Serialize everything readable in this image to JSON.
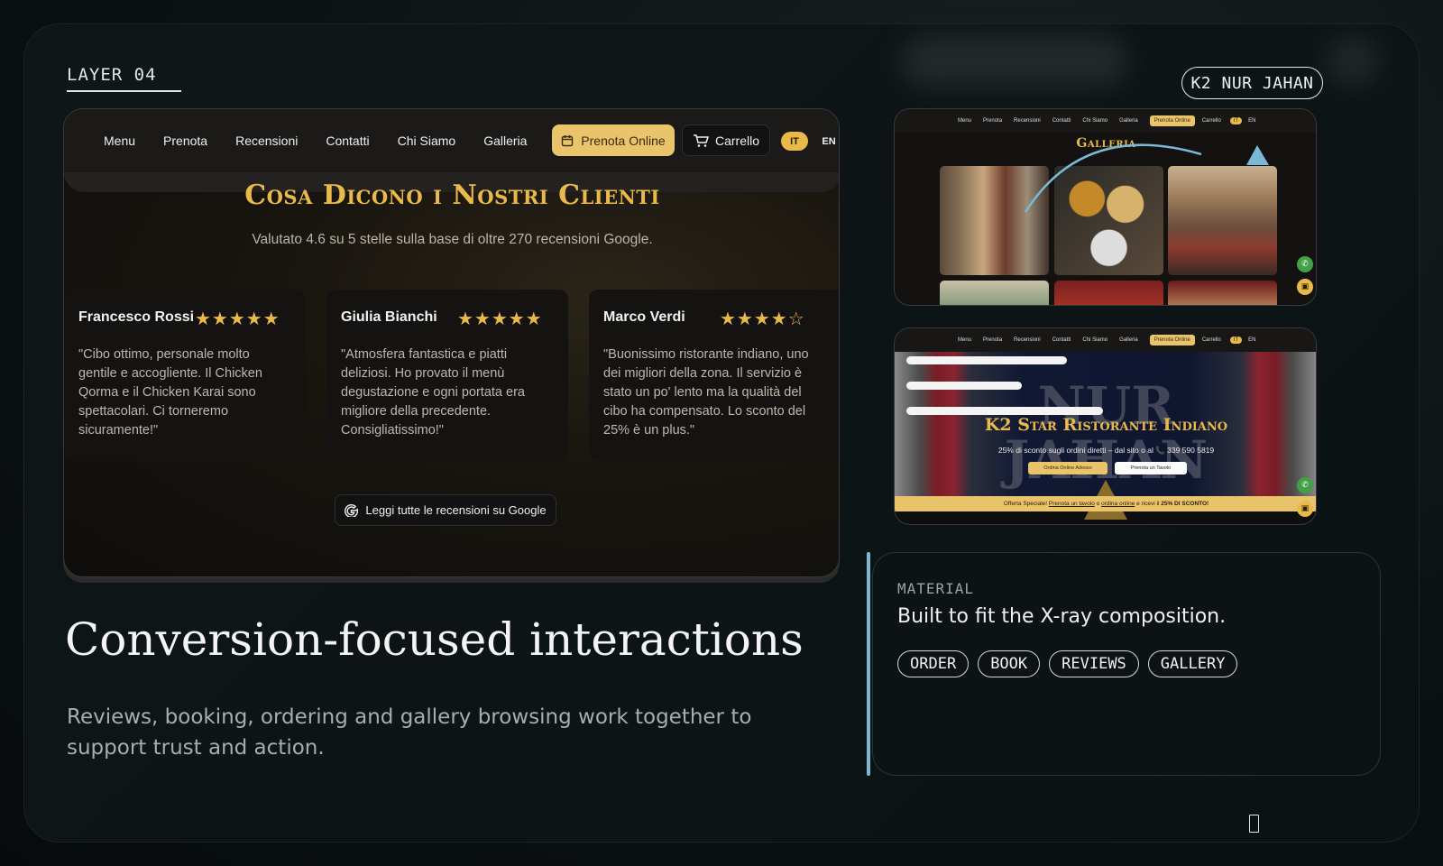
{
  "layer_label": "LAYER 04",
  "brand_pill": "K2 NUR JAHAN",
  "site": {
    "nav": {
      "links": [
        "Menu",
        "Prenota",
        "Recensioni",
        "Contatti",
        "Chi Siamo",
        "Galleria"
      ],
      "prenota_button": "Prenota Online",
      "cart_button": "Carrello",
      "lang_it": "IT",
      "lang_en": "EN"
    },
    "reviews": {
      "title": "Cosa Dicono i Nostri Clienti",
      "subtitle": "Valutato 4.6 su 5 stelle sulla base di oltre 270 recensioni Google.",
      "items": [
        {
          "name": "Francesco Rossi",
          "stars": "★★★★★",
          "rating": 5,
          "text": "\"Cibo ottimo, personale molto gentile e accogliente. Il Chicken Qorma e il Chicken Karai sono spettacolari. Ci torneremo sicuramente!\""
        },
        {
          "name": "Giulia Bianchi",
          "stars": "★★★★★",
          "rating": 5,
          "text": "\"Atmosfera fantastica e piatti deliziosi. Ho provato il menù degustazione e ogni portata era migliore della precedente. Consigliatissimo!\""
        },
        {
          "name": "Marco Verdi",
          "stars": "★★★★☆",
          "rating": 4,
          "text": "\"Buonissimo ristorante indiano, uno dei migliori della zona. Il servizio è stato un po' lento ma la qualità del cibo ha compensato. Lo sconto del 25% è un plus.\""
        }
      ],
      "google_button": "Leggi tutte le recensioni su Google"
    }
  },
  "headline": "Conversion-focused interactions",
  "subtext": "Reviews, booking, ordering and gallery browsing work together to support trust and action.",
  "thumbnails": {
    "mini_nav": {
      "links": [
        "Menu",
        "Prenota",
        "Recensioni",
        "Contatti",
        "Chi Siamo",
        "Galleria"
      ],
      "prenota": "Prenota Online",
      "cart": "Carrello",
      "it": "IT",
      "en": "EN"
    },
    "gallery_title": "Galleria",
    "hero": {
      "bg_text_1": "NUR",
      "bg_text_2": "JAHAN",
      "title": "K2 Star Ristorante Indiano",
      "subtitle": "25% di sconto sugli ordini diretti – dal sito o al 📞 339 590 5819",
      "order_button": "Ordina Online Adesso",
      "table_button": "Prenota un Tavolo"
    },
    "offer_bar": {
      "prefix": "Offerta Speciale!",
      "link1": "Prenota un tavolo",
      "mid": "o",
      "link2": "ordina online",
      "suffix": "e ricevi il",
      "bold": "25% DI SCONTO!"
    }
  },
  "material": {
    "label": "MATERIAL",
    "heading": "Built to fit the X-ray composition.",
    "tags": [
      "ORDER",
      "BOOK",
      "REVIEWS",
      "GALLERY"
    ]
  },
  "colors": {
    "accent_gold": "#e9b949",
    "accent_blue": "#7ab8d8",
    "background": "#0d1416"
  }
}
